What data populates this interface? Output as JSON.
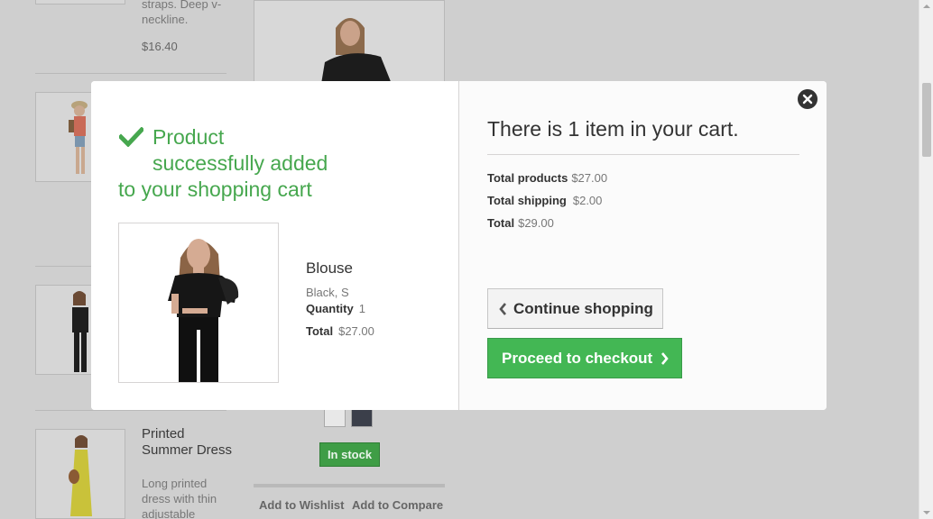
{
  "background": {
    "products": [
      {
        "desc": "straps. Deep v-neckline.",
        "price": "$16.40"
      },
      {
        "name": "Printed Summer Dress",
        "desc": "Long printed dress with thin adjustable"
      }
    ],
    "stock_label": "In stock",
    "wishlist_label": "Add to Wishlist",
    "compare_label": "Add to Compare"
  },
  "modal": {
    "success_message": [
      "Product",
      "successfully added",
      "to your shopping cart"
    ],
    "product": {
      "name": "Blouse",
      "attributes": "Black, S",
      "quantity_label": "Quantity",
      "quantity": "1",
      "total_label": "Total",
      "total": "$27.00"
    },
    "cart": {
      "count_text": "There is 1 item in your cart.",
      "total_products_label": "Total products",
      "total_products": "$27.00",
      "total_shipping_label": "Total shipping",
      "total_shipping": "$2.00",
      "total_label": "Total",
      "total": "$29.00"
    },
    "continue_label": "Continue shopping",
    "checkout_label": "Proceed to checkout"
  },
  "icons": {
    "check": "check-icon",
    "close": "close-icon",
    "chevron_left": "chevron-left-icon",
    "chevron_right": "chevron-right-icon"
  },
  "colors": {
    "success": "#46a74e",
    "checkout": "#43b754",
    "overlay": "#cfcfcf"
  }
}
